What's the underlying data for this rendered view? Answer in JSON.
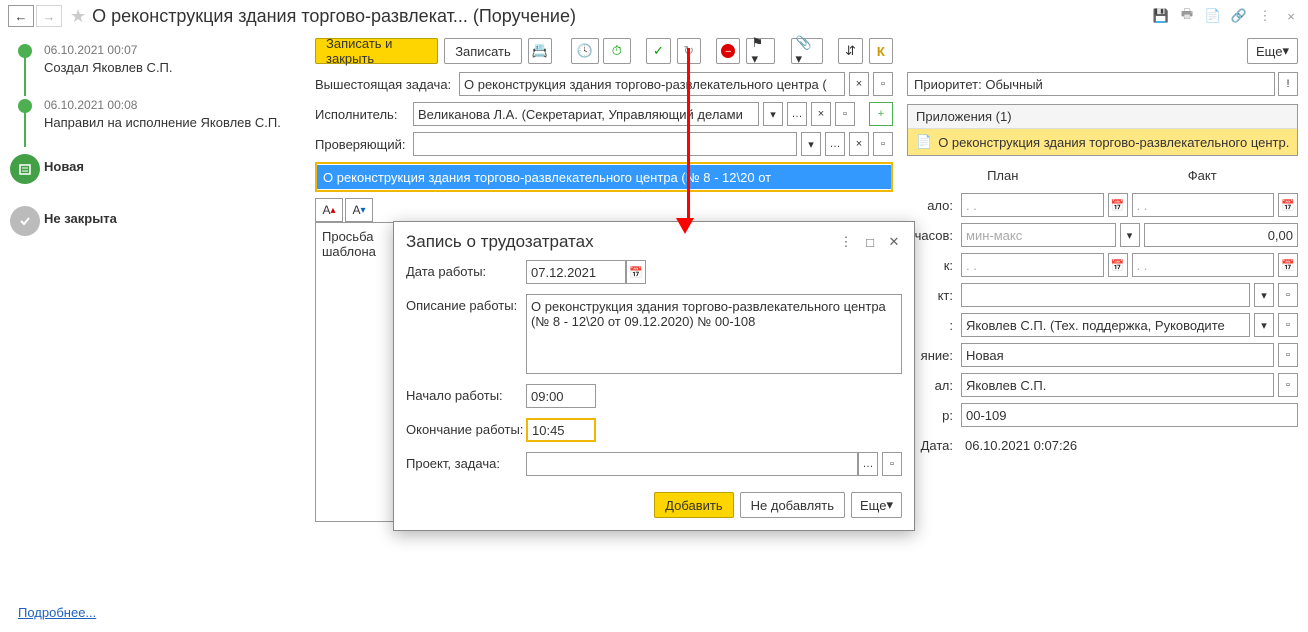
{
  "header": {
    "title": "О реконструкция здания торгово-развлекат... (Поручение)"
  },
  "timeline": [
    {
      "date": "06.10.2021 00:07",
      "text": "Создал Яковлев С.П.",
      "type": "small"
    },
    {
      "date": "06.10.2021 00:08",
      "text": "Направил на исполнение Яковлев С.П.",
      "type": "small"
    },
    {
      "text": "Новая",
      "type": "big-green"
    },
    {
      "text": "Не закрыта",
      "type": "big-grey"
    }
  ],
  "toolbar": {
    "save_close": "Записать и закрыть",
    "save": "Записать",
    "more": "Еще"
  },
  "form": {
    "parent_task_label": "Вышестоящая задача:",
    "parent_task_value": "О реконструкция здания торгово-развлекательного центра (",
    "executor_label": "Исполнитель:",
    "executor_value": "Великанова Л.А. (Секретариат, Управляющий делами",
    "reviewer_label": "Проверяющий:",
    "reviewer_value": "",
    "subject": "О реконструкция здания торгово-развлекательного центра (№ 8 - 12\\20 от",
    "body_line1": "Просьба",
    "body_line2": "шаблона"
  },
  "right": {
    "priority_label": "Приоритет:",
    "priority_value": "Обычный",
    "attachments_title": "Приложения (1)",
    "attachment_name": "О реконструкция здания торгово-развлекательного центр...",
    "plan": "План",
    "fact": "Факт",
    "labels": {
      "start": "ало:",
      "hours": "часов:",
      "k": "к:",
      "kt": "кт:",
      "colon": ":",
      "yanie": "яние:",
      "al": "ал:",
      "r": "р:",
      "date": "Дата:"
    },
    "fields": {
      "date_empty": "  .  .    ",
      "hours_placeholder": "мин-макс",
      "fact_hours": "0,00",
      "author": "Яковлев С.П. (Тех. поддержка, Руководите",
      "state": "Новая",
      "al": "Яковлев С.П.",
      "number": "00-109",
      "created": "06.10.2021  0:07:26"
    }
  },
  "dialog": {
    "title": "Запись о трудозатратах",
    "date_label": "Дата работы:",
    "date_value": "07.12.2021",
    "desc_label": "Описание работы:",
    "desc_value": "О реконструкция здания торгово-развлекательного центра (№ 8 - 12\\20 от 09.12.2020) № 00-108",
    "start_label": "Начало работы:",
    "start_value": "09:00",
    "end_label": "Окончание работы:",
    "end_value": "10:45",
    "project_label": "Проект, задача:",
    "add": "Добавить",
    "skip": "Не добавлять",
    "more": "Еще"
  },
  "details_link": "Подробнее..."
}
